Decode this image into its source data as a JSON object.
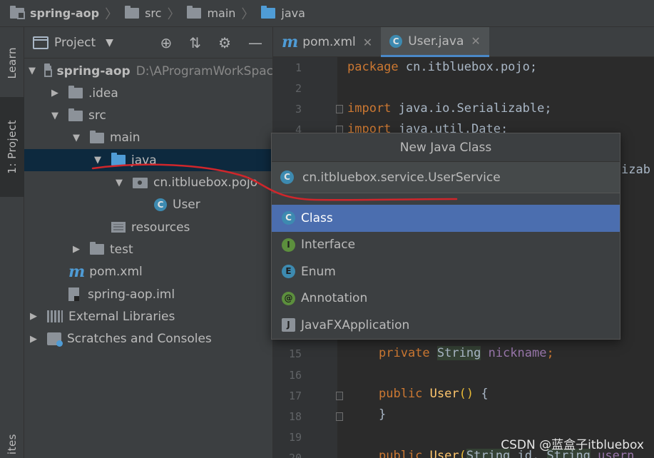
{
  "breadcrumb": [
    "spring-aop",
    "src",
    "main",
    "java"
  ],
  "left_strip": {
    "learn": "Learn",
    "project": "1: Project",
    "favorites": "ites"
  },
  "project_panel": {
    "title": "Project",
    "tree": [
      {
        "label": "spring-aop",
        "path": "D:\\AProgramWorkSpac",
        "arrow": "▼",
        "depth": 0,
        "icon": "module-folder"
      },
      {
        "label": ".idea",
        "arrow": "▶",
        "depth": 1,
        "icon": "folder"
      },
      {
        "label": "src",
        "arrow": "▼",
        "depth": 1,
        "icon": "folder"
      },
      {
        "label": "main",
        "arrow": "▼",
        "depth": 2,
        "icon": "folder"
      },
      {
        "label": "java",
        "arrow": "▼",
        "depth": 3,
        "icon": "source-folder",
        "selected": true
      },
      {
        "label": "cn.itbluebox.pojo",
        "arrow": "▼",
        "depth": 4,
        "icon": "package"
      },
      {
        "label": "User",
        "arrow": "",
        "depth": 5,
        "icon": "class"
      },
      {
        "label": "resources",
        "arrow": "",
        "depth": 3,
        "icon": "resources-folder"
      },
      {
        "label": "test",
        "arrow": "▶",
        "depth": 2,
        "icon": "folder"
      },
      {
        "label": "pom.xml",
        "arrow": "",
        "depth": 1,
        "icon": "maven"
      },
      {
        "label": "spring-aop.iml",
        "arrow": "",
        "depth": 1,
        "icon": "iml-file"
      },
      {
        "label": "External Libraries",
        "arrow": "▶",
        "depth": 0,
        "icon": "libraries"
      },
      {
        "label": "Scratches and Consoles",
        "arrow": "▶",
        "depth": 0,
        "icon": "scratches"
      }
    ]
  },
  "editor_tabs": [
    {
      "label": "pom.xml",
      "icon": "maven",
      "active": false
    },
    {
      "label": "User.java",
      "icon": "class",
      "active": true
    }
  ],
  "editor": {
    "line_numbers": [
      "1",
      "2",
      "3",
      "4",
      "15",
      "16",
      "17",
      "18",
      "19",
      "20"
    ],
    "code": {
      "l1_kw": "package",
      "l1_rest": " cn.itbluebox.pojo;",
      "l3_kw": "import",
      "l3_rest": " java.io.Serializable;",
      "l4_kw": "import",
      "l4_rest": " java.util.Date;",
      "l5_partial": "izab",
      "l15_kw": "private",
      "l15_type": "String",
      "l15_field": "nickname",
      "l17_kw": "public",
      "l17_ctor": "User",
      "l17_parens": "()",
      "l17_brace": "{",
      "l18_brace": "}",
      "l20_kw": "public",
      "l20_ctor": "User",
      "l20_paren": "(",
      "l20_type1": "String",
      "l20_arg1": " id,",
      "l20_type2": "String",
      "l20_arg2": " usern"
    }
  },
  "dialog": {
    "title": "New Java Class",
    "name_value": "cn.itbluebox.service.UserService",
    "kinds": [
      {
        "label": "Class",
        "icon": "C",
        "selected": true
      },
      {
        "label": "Interface",
        "icon": "I",
        "selected": false
      },
      {
        "label": "Enum",
        "icon": "E",
        "selected": false
      },
      {
        "label": "Annotation",
        "icon": "@",
        "selected": false
      },
      {
        "label": "JavaFXApplication",
        "icon": "J",
        "selected": false
      }
    ]
  },
  "watermark": "CSDN @蓝盒子itbluebox",
  "colors": {
    "selection": "#0d293e",
    "list_selection": "#4b6eaf",
    "keyword": "#cc7832",
    "annotation_stroke": "#d0262b"
  }
}
